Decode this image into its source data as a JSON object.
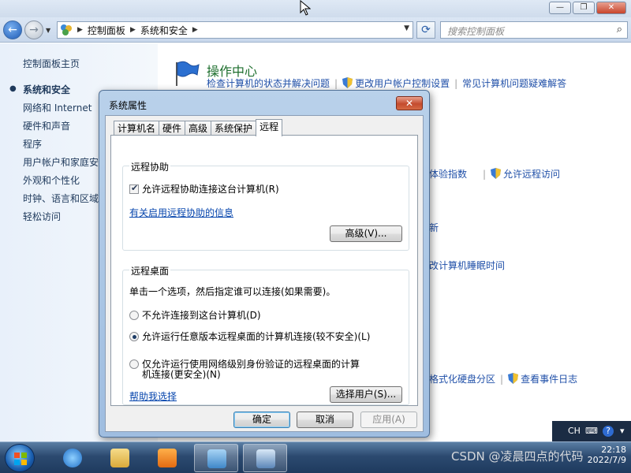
{
  "explorer": {
    "window_buttons": {
      "minimize": "—",
      "restore": "❐",
      "close": "✕"
    },
    "breadcrumb": [
      "控制面板",
      "系统和安全"
    ],
    "search": {
      "placeholder": "搜索控制面板"
    },
    "sidebar": {
      "items": [
        {
          "label": "控制面板主页",
          "current": false
        },
        {
          "label": "系统和安全",
          "current": true
        },
        {
          "label": "网络和 Internet",
          "current": false
        },
        {
          "label": "硬件和声音",
          "current": false
        },
        {
          "label": "程序",
          "current": false
        },
        {
          "label": "用户帐户和家庭安",
          "current": false
        },
        {
          "label": "外观和个性化",
          "current": false
        },
        {
          "label": "时钟、语言和区域",
          "current": false
        },
        {
          "label": "轻松访问",
          "current": false
        }
      ]
    },
    "main": {
      "action_center_title": "操作中心",
      "action_center_links": [
        "检查计算机的状态并解决问题",
        "更改用户帐户控制设置",
        "常见计算机问题疑难解答"
      ],
      "partial_links": {
        "experience_index": "体验指数",
        "allow_remote": "允许远程访问",
        "update": "新",
        "sleep": "改计算机睡眠时间",
        "format_partition": "格式化硬盘分区",
        "event_log": "查看事件日志"
      }
    }
  },
  "dialog": {
    "title": "系统属性",
    "close": "✕",
    "tabs": [
      {
        "label": "计算机名",
        "active": false
      },
      {
        "label": "硬件",
        "active": false
      },
      {
        "label": "高级",
        "active": false
      },
      {
        "label": "系统保护",
        "active": false
      },
      {
        "label": "远程",
        "active": true
      }
    ],
    "remote_assistance": {
      "group_label": "远程协助",
      "allow_checkbox": {
        "label": "允许远程协助连接这台计算机(R)",
        "checked": true
      },
      "info_link": "有关启用远程协助的信息",
      "advanced_button": "高级(V)..."
    },
    "remote_desktop": {
      "group_label": "远程桌面",
      "instruction": "单击一个选项，然后指定谁可以连接(如果需要)。",
      "options": [
        {
          "label": "不允许连接到这台计算机(D)",
          "selected": false
        },
        {
          "label": "允许运行任意版本远程桌面的计算机连接(较不安全)(L)",
          "selected": true
        },
        {
          "label_line1": "仅允许运行使用网络级别身份验证的远程桌面的计算",
          "label_line2": "机连接(更安全)(N)",
          "selected": false
        }
      ],
      "help_link": "帮助我选择",
      "select_users_button": "选择用户(S)..."
    },
    "buttons": {
      "ok": "确定",
      "cancel": "取消",
      "apply": "应用(A)"
    }
  },
  "taskbar": {
    "tray": {
      "language": "CH",
      "help": "?"
    },
    "clock": {
      "time": "22:18",
      "date": "2022/7/9"
    },
    "watermark": "CSDN @凌晨四点的代码"
  },
  "colors": {
    "link": "#1f4fa8",
    "category_title": "#1e6f2e",
    "sidebar_text": "#1e395b",
    "taskbar": "#2c4a70",
    "dialog_frame": "#b9d1ea"
  }
}
